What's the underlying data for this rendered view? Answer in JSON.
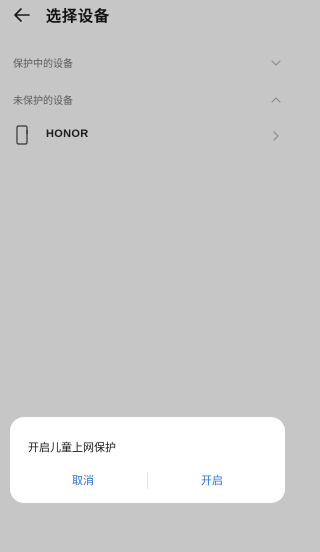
{
  "header": {
    "title": "选择设备",
    "back_icon": "back-arrow-icon"
  },
  "sections": {
    "protected": {
      "label": "保护中的设备",
      "icon": "chevron-down-icon",
      "expanded": false
    },
    "unprotected": {
      "label": "未保护的设备",
      "icon": "chevron-up-icon",
      "expanded": true
    }
  },
  "devices": [
    {
      "name": "HONOR",
      "icon": "phone-icon",
      "chevron_icon": "chevron-right-icon"
    }
  ],
  "dialog": {
    "title": "开启儿童上网保护",
    "cancel_label": "取消",
    "confirm_label": "开启"
  },
  "colors": {
    "screen_background": "#c6c6c6",
    "dialog_background": "#ffffff",
    "accent": "#2f6fe0",
    "section_label": "#5b5b5b"
  }
}
